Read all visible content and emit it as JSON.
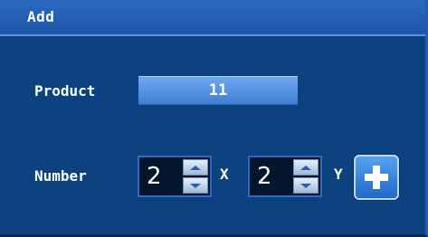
{
  "dialog": {
    "title": "Add",
    "product": {
      "label": "Product",
      "value": "11"
    },
    "number": {
      "label": "Number",
      "x": {
        "value": "2",
        "axis_label": "X"
      },
      "y": {
        "value": "2",
        "axis_label": "Y"
      }
    },
    "add_button": {
      "icon": "plus-icon"
    }
  },
  "colors": {
    "background": "#0c4280",
    "titlebar": "#2b69c1",
    "field": "#5a96e6",
    "spinner_bg": "#04152e",
    "accent": "#1f68cc"
  }
}
